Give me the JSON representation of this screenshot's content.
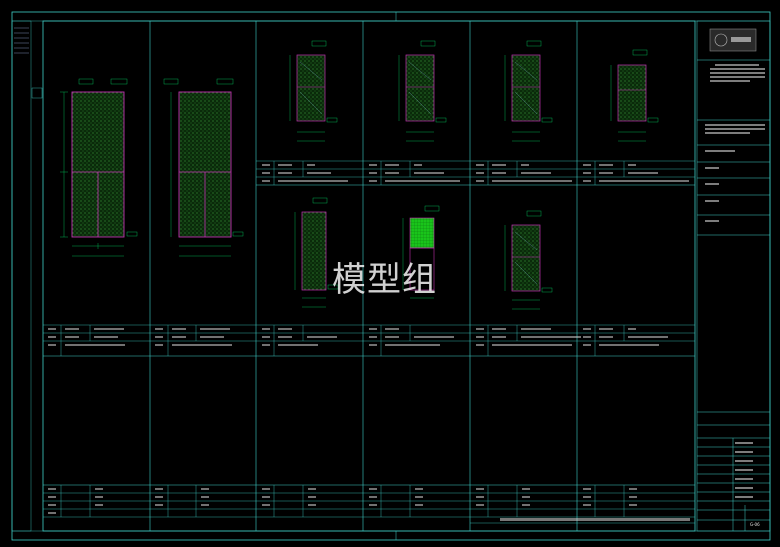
{
  "watermark": "模型组",
  "title_block": {
    "logo_text": "国家工程",
    "sheet_number": "G-06"
  },
  "colors": {
    "frame": "#3fd0c9",
    "door_outline": "#c02fb0",
    "door_fill": "#2a8a2a",
    "dimension": "#00d060",
    "text": "#e8e8e8",
    "grid_fill": "#19c41a",
    "background": "#000000"
  },
  "icons": [
    "logo-seal-icon"
  ]
}
